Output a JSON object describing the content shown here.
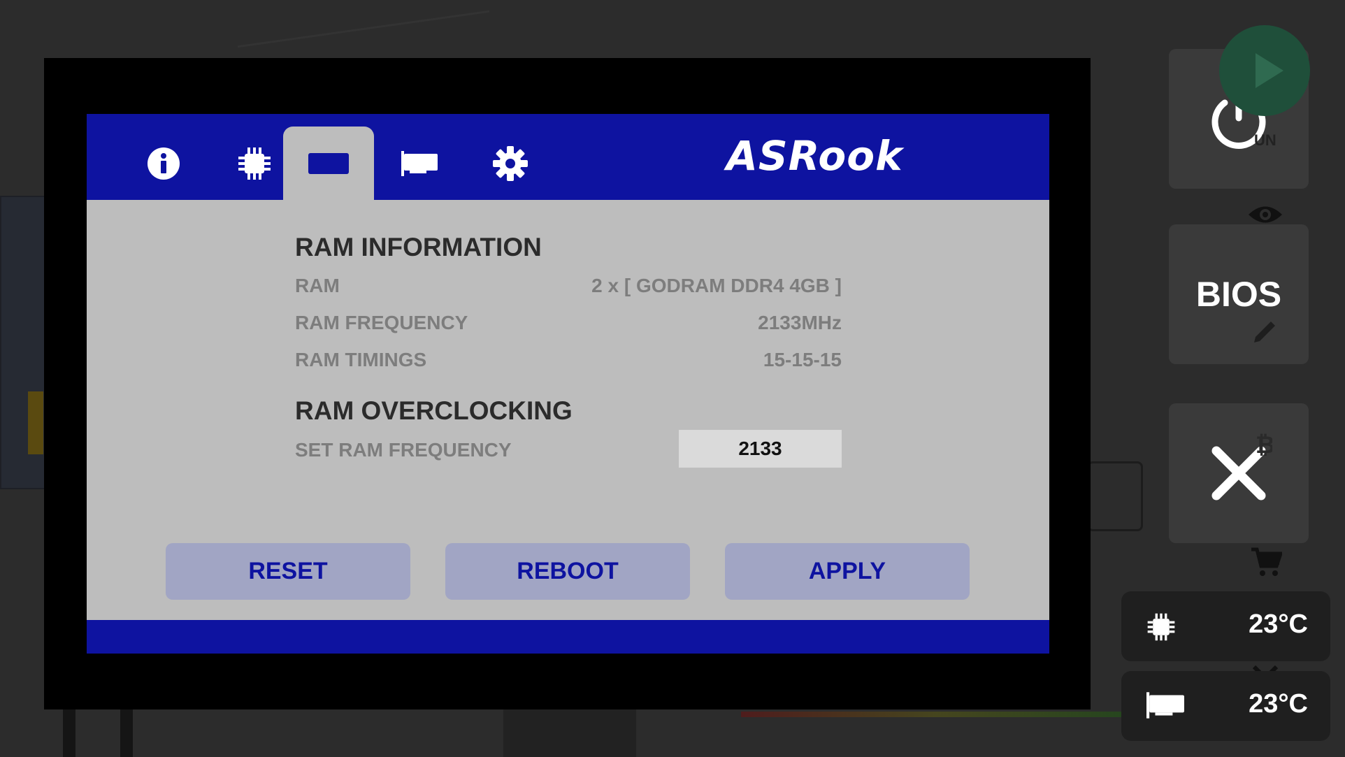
{
  "monitor": {
    "brand": "ASRook",
    "tabs": [
      {
        "name": "info",
        "icon": "info-icon",
        "active": false
      },
      {
        "name": "cpu",
        "icon": "chip-icon",
        "active": false
      },
      {
        "name": "ram",
        "icon": "ram-icon",
        "active": true
      },
      {
        "name": "gpu",
        "icon": "gpu-icon",
        "active": false
      },
      {
        "name": "settings",
        "icon": "gear-icon",
        "active": false
      }
    ],
    "ram_information": {
      "title": "RAM INFORMATION",
      "rows": [
        {
          "label": "RAM",
          "value": "2 x [ GODRAM DDR4 4GB ]"
        },
        {
          "label": "RAM FREQUENCY",
          "value": "2133MHz"
        },
        {
          "label": "RAM TIMINGS",
          "value": "15-15-15"
        }
      ]
    },
    "ram_overclocking": {
      "title": "RAM OVERCLOCKING",
      "set_frequency_label": "SET RAM FREQUENCY",
      "set_frequency_value": "2133"
    },
    "buttons": {
      "reset": "RESET",
      "reboot": "REBOOT",
      "apply": "APPLY"
    },
    "colors": {
      "accent_blue": "#0e13a0",
      "screen_bg": "#bdbdbd",
      "button_bg": "#a1a5c4"
    }
  },
  "sidebar": {
    "run_label": "UN",
    "bios_label": "BIOS",
    "cpu_temp": "23°C",
    "gpu_temp": "23°C"
  }
}
